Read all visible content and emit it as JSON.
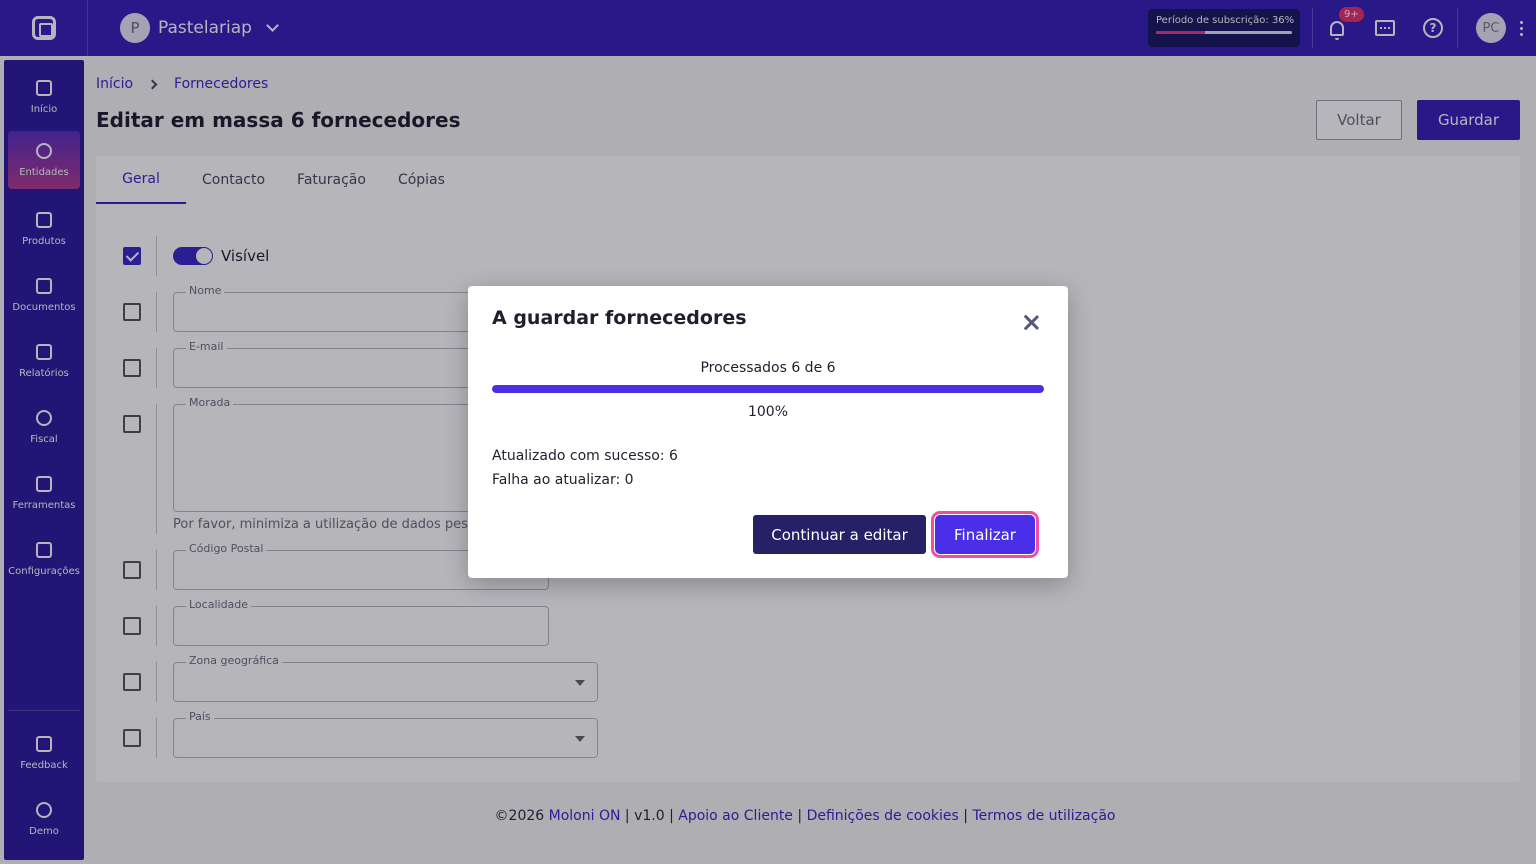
{
  "topbar": {
    "company_initial": "P",
    "company_name": "Pastelariap",
    "subscription_label": "Período de subscrição: 36%",
    "subscription_progress": 0.36,
    "notifications_badge": "9+",
    "user_initials": "PC"
  },
  "sidebar": {
    "items": [
      {
        "label": "Início",
        "icon": "grid-icon"
      },
      {
        "label": "Entidades",
        "icon": "user-icon"
      },
      {
        "label": "Produtos",
        "icon": "basket-icon"
      },
      {
        "label": "Documentos",
        "icon": "document-icon"
      },
      {
        "label": "Relatórios",
        "icon": "chart-icon"
      },
      {
        "label": "Fiscal",
        "icon": "tree-icon"
      },
      {
        "label": "Ferramentas",
        "icon": "tools-icon"
      },
      {
        "label": "Configurações",
        "icon": "sliders-icon"
      }
    ],
    "bottom": [
      {
        "label": "Feedback",
        "icon": "feedback-icon"
      },
      {
        "label": "Demo",
        "icon": "rocket-icon"
      }
    ]
  },
  "breadcrumb": {
    "home": "Início",
    "current": "Fornecedores"
  },
  "page": {
    "title": "Editar em massa 6 fornecedores",
    "back_label": "Voltar",
    "save_label": "Guardar"
  },
  "tabs": [
    "Geral",
    "Contacto",
    "Faturação",
    "Cópias"
  ],
  "form": {
    "visible_label": "Visível",
    "fields": {
      "nome": "Nome",
      "email": "E-mail",
      "morada": "Morada",
      "codigo_postal": "Código Postal",
      "localidade": "Localidade",
      "zona": "Zona geográfica",
      "pais": "País"
    },
    "hint": "Por favor, minimiza a utilização de dados pessoais"
  },
  "footer": {
    "copyright": "©2026",
    "brand": "Moloni ON",
    "version": "v1.0",
    "support": "Apoio ao Cliente",
    "cookies": "Definições de cookies",
    "terms": "Termos de utilização"
  },
  "modal": {
    "title": "A guardar fornecedores",
    "progress_text": "Processados 6 de 6",
    "progress_fraction": 1.0,
    "progress_percent": "100%",
    "success_text": "Atualizado com sucesso: 6",
    "fail_text": "Falha ao atualizar: 0",
    "continue_label": "Continuar a editar",
    "finish_label": "Finalizar"
  }
}
